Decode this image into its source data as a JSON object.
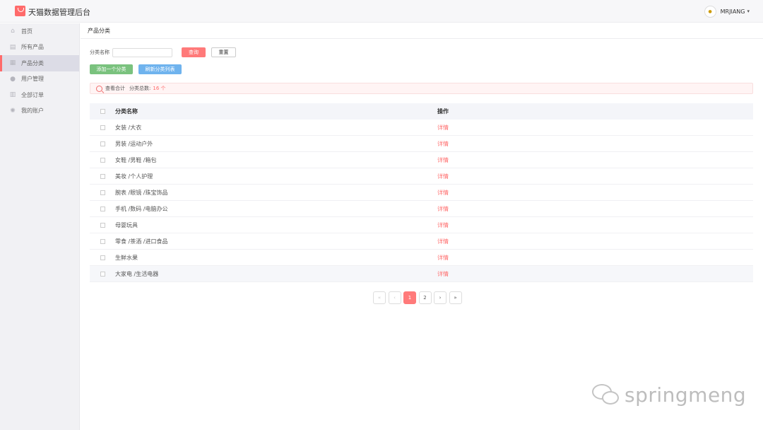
{
  "header": {
    "app_title": "天猫数据管理后台",
    "username": "MRJIANG",
    "avatar_text": "●",
    "caret": "▾"
  },
  "sidebar": {
    "items": [
      {
        "label": "首页",
        "icon": "home-icon",
        "glyph": "⌂"
      },
      {
        "label": "所有产品",
        "icon": "product-icon",
        "glyph": "▤"
      },
      {
        "label": "产品分类",
        "icon": "grid-icon",
        "glyph": "▦"
      },
      {
        "label": "用户管理",
        "icon": "user-icon",
        "glyph": "●"
      },
      {
        "label": "全部订单",
        "icon": "order-icon",
        "glyph": "▥"
      },
      {
        "label": "我的账户",
        "icon": "gear-icon",
        "glyph": "✺"
      }
    ]
  },
  "breadcrumb": "产品分类",
  "search": {
    "label": "分类名称",
    "value": "",
    "query_label": "查询",
    "reset_label": "重置"
  },
  "actions": {
    "add_label": "添加一个分类",
    "refresh_label": "刷新分类列表"
  },
  "summary": {
    "prefix": "查看合计",
    "label": "分类总数:",
    "count": "16 个"
  },
  "table": {
    "headers": [
      "分类名称",
      "操作"
    ],
    "rows": [
      {
        "name": "女装 /大衣",
        "op": "详情"
      },
      {
        "name": "男装 /运动户外",
        "op": "详情"
      },
      {
        "name": "女鞋 /男鞋 /箱包",
        "op": "详情"
      },
      {
        "name": "美妆 /个人护理",
        "op": "详情"
      },
      {
        "name": "腕表 /眼镜 /珠宝饰品",
        "op": "详情"
      },
      {
        "name": "手机 /数码 /电脑办公",
        "op": "详情"
      },
      {
        "name": "母婴玩具",
        "op": "详情"
      },
      {
        "name": "零食 /茶酒 /进口食品",
        "op": "详情"
      },
      {
        "name": "生鲜水果",
        "op": "详情"
      },
      {
        "name": "大家电 /生活电器",
        "op": "详情"
      }
    ]
  },
  "pagination": {
    "first": "«",
    "prev": "‹",
    "pages": [
      "1",
      "2"
    ],
    "next": "›",
    "last": "»"
  },
  "watermark": "springmeng",
  "colors": {
    "accent": "#ff6b6b",
    "add_button": "#7ac27e",
    "refresh_button": "#6fb3ee"
  }
}
